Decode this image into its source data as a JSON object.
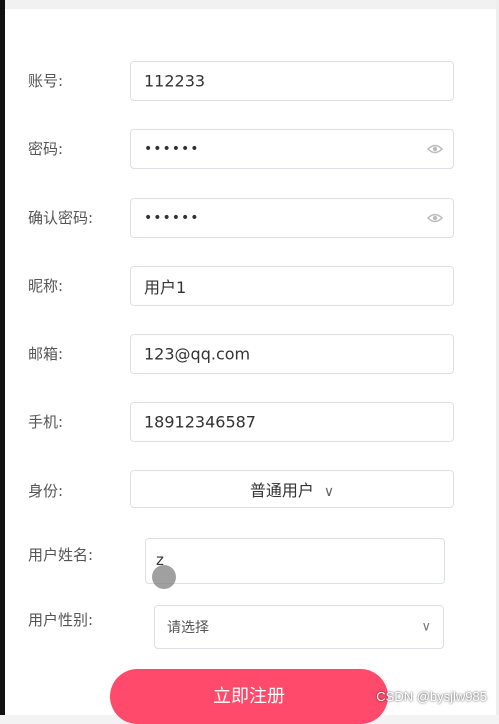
{
  "form": {
    "fields": [
      {
        "label": "账号:",
        "value": "112233"
      },
      {
        "label": "密码:",
        "value": "••••••"
      },
      {
        "label": "确认密码:",
        "value": "••••••"
      },
      {
        "label": "昵称:",
        "value": "用户1"
      },
      {
        "label": "邮箱:",
        "value": "123@qq.com"
      },
      {
        "label": "手机:",
        "value": "18912346587"
      }
    ],
    "identity": {
      "label": "身份:",
      "value": "普通用户",
      "icon": "chevron-down-icon"
    },
    "real_name": {
      "label": "用户姓名:",
      "value": "z"
    },
    "gender": {
      "label": "用户性别:",
      "value": "请选择",
      "icon": "chevron-down-icon"
    }
  },
  "submit_label": "立即注册",
  "watermark": "CSDN @bysjlw985",
  "colors": {
    "border": "#dcdfe6",
    "accent": "#ff4a6b"
  }
}
